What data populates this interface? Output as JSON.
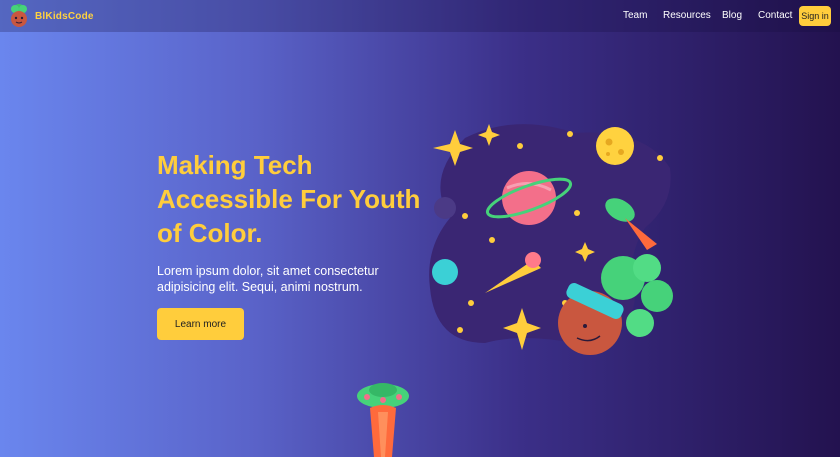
{
  "brand": {
    "name": "BlKidsCode"
  },
  "nav": {
    "links": [
      "Team",
      "Resources",
      "Blog",
      "Contact"
    ],
    "signin_label": "Sign in"
  },
  "hero": {
    "title": "Making Tech Accessible For Youth of Color.",
    "subtitle": "Lorem ipsum dolor, sit amet consectetur adipisicing elit. Sequi, animi nostrum.",
    "cta_label": "Learn more"
  },
  "colors": {
    "accent": "#ffcd3c",
    "gradient_start": "#6a86ee",
    "gradient_end": "#23124f",
    "blob": "#3a2673"
  },
  "icons": [
    "logo-avatar-icon",
    "space-illustration",
    "ufo-icon"
  ]
}
